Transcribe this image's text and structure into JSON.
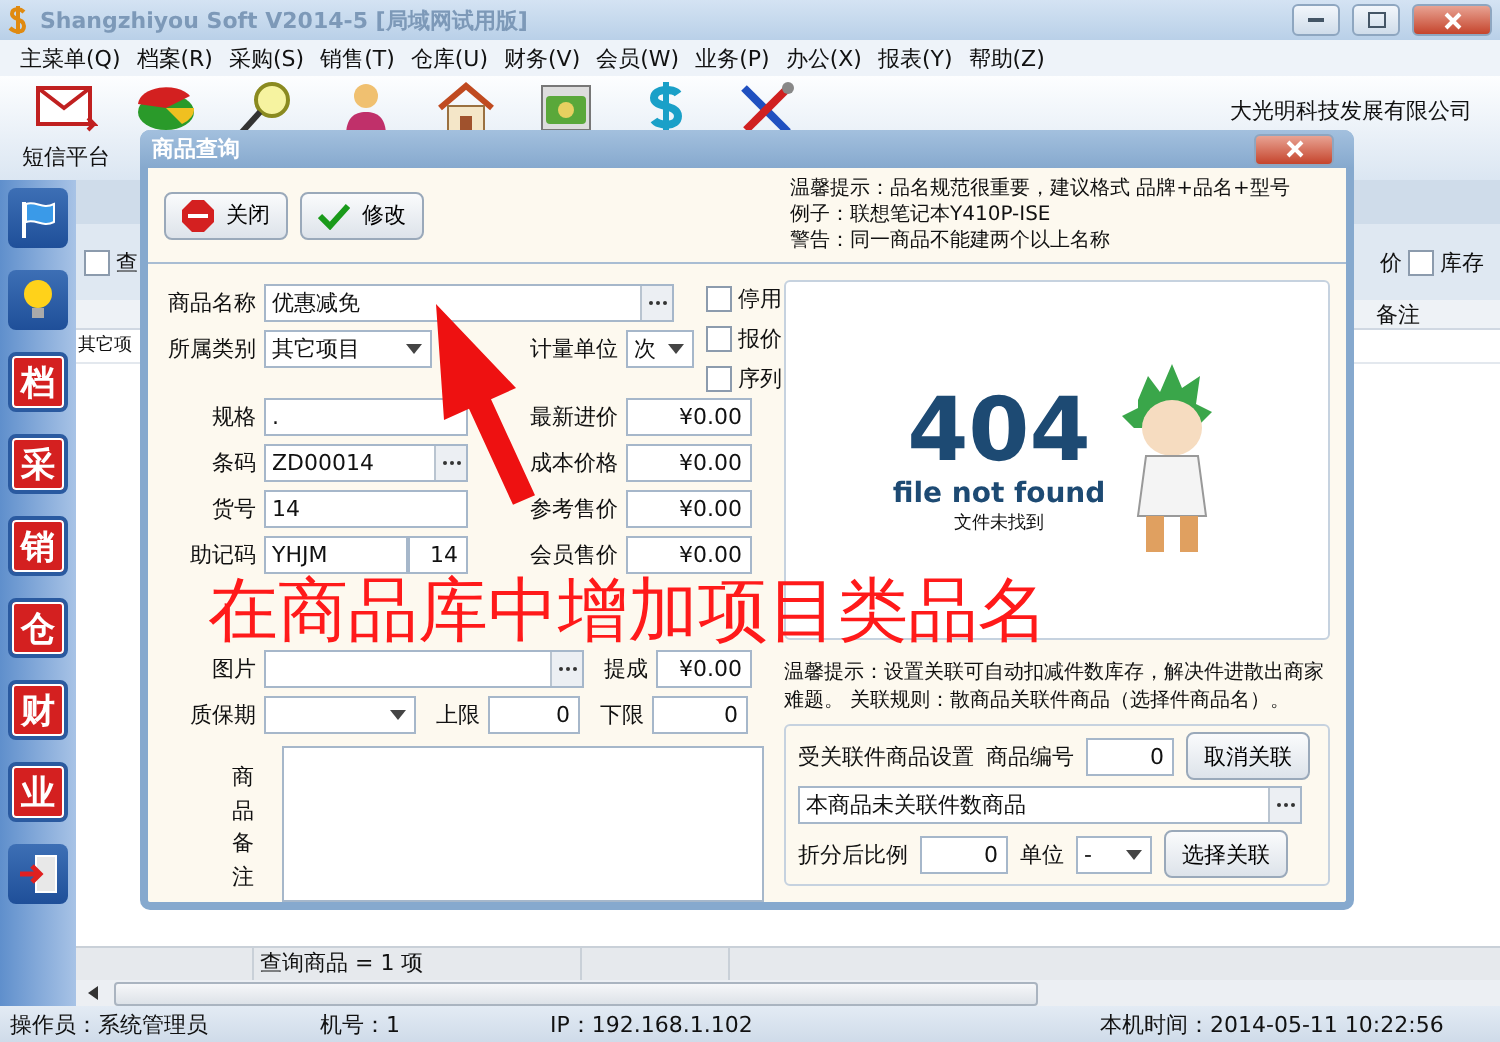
{
  "window": {
    "title": "Shangzhiyou Soft V2014-5 [局域网试用版]"
  },
  "menu": [
    "主菜单(Q)",
    "档案(R)",
    "采购(S)",
    "销售(T)",
    "仓库(U)",
    "财务(V)",
    "会员(W)",
    "业务(P)",
    "办公(X)",
    "报表(Y)",
    "帮助(Z)"
  ],
  "toolbar": {
    "items": [
      {
        "kind": "mail",
        "label": "短信平台"
      },
      {
        "kind": "chart"
      },
      {
        "kind": "search"
      },
      {
        "kind": "person"
      },
      {
        "kind": "house"
      },
      {
        "kind": "money"
      },
      {
        "kind": "dollar"
      },
      {
        "kind": "tools"
      }
    ],
    "company": "大光明科技发展有限公司"
  },
  "sidebar": [
    {
      "kind": "flag"
    },
    {
      "kind": "bulb"
    },
    {
      "kind": "char",
      "label": "档"
    },
    {
      "kind": "char",
      "label": "采"
    },
    {
      "kind": "char",
      "label": "销"
    },
    {
      "kind": "char",
      "label": "仓"
    },
    {
      "kind": "char",
      "label": "财"
    },
    {
      "kind": "char",
      "label": "业"
    },
    {
      "kind": "exit"
    }
  ],
  "list": {
    "filter_left": {
      "label": "查",
      "checked": false
    },
    "filter_right_text": "价",
    "filter_right": {
      "label": "库存",
      "checked": false
    },
    "column": "备注",
    "row": "其它项",
    "status_cell": "查询商品 = 1 项"
  },
  "status_bar": [
    "操作员：系统管理员",
    "机号：1",
    "IP：192.168.1.102",
    "本机时间：2014-05-11 10:22:56"
  ],
  "dialog": {
    "title": "商品查询",
    "buttons": [
      {
        "kind": "stop",
        "label": "关闭"
      },
      {
        "kind": "check",
        "label": "修改"
      }
    ],
    "tips": [
      "温馨提示：品名规范很重要，建议格式  品牌+品名+型号",
      "例子：联想笔记本Y410P-ISE",
      "警告：同一商品不能建两个以上名称"
    ],
    "name": {
      "label": "商品名称",
      "value": "优惠减免"
    },
    "checks": [
      {
        "label": "停用",
        "checked": false
      },
      {
        "label": "报价",
        "checked": false
      },
      {
        "label": "序列",
        "checked": false
      }
    ],
    "category": {
      "label": "所属类别",
      "value": "其它项目"
    },
    "unit": {
      "label": "计量单位",
      "value": "次"
    },
    "rows": [
      {
        "label": "规格",
        "value": ".",
        "lookup": false,
        "price_label": "最新进价",
        "price": "¥0.00"
      },
      {
        "label": "条码",
        "value": "ZD00014",
        "lookup": true,
        "price_label": "成本价格",
        "price": "¥0.00"
      },
      {
        "label": "货号",
        "value": "14",
        "lookup": false,
        "price_label": "参考售价",
        "price": "¥0.00"
      },
      {
        "label": "助记码",
        "value": "YHJM",
        "extra": "14",
        "lookup": false,
        "price_label": "会员售价",
        "price": "¥0.00"
      }
    ],
    "picture_row": {
      "label": "图片",
      "lookup": true,
      "price_label": "提成",
      "price": "¥0.00"
    },
    "warranty": {
      "label": "质保期",
      "upper_label": "上限",
      "upper": "0",
      "lower_label": "下限",
      "lower": "0"
    },
    "notes_label": "商品备注",
    "image": {
      "code": "404",
      "caption": "file not found",
      "subcaption": "文件未找到"
    },
    "assoc_tip": "温馨提示：设置关联可自动扣减件数库存，解决件进散出商家难题。 关联规则：散商品关联件商品（选择件商品名）。",
    "assoc": {
      "title": "受关联件商品设置",
      "code_label": "商品编号",
      "code": "0",
      "cancel": "取消关联",
      "product": "本商品未关联件数商品",
      "ratio_label": "折分后比例",
      "ratio": "0",
      "unit_label": "单位",
      "unit": "-",
      "select": "选择关联"
    }
  },
  "annotation": "在商品库中增加项目类品名"
}
